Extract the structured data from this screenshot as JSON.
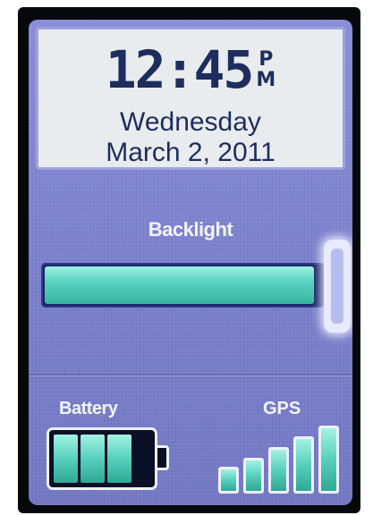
{
  "clock": {
    "time": "12:45",
    "meridiem_top": "P",
    "meridiem_bottom": "M",
    "weekday": "Wednesday",
    "date": "March 2, 2011"
  },
  "backlight": {
    "label": "Backlight",
    "level": 0.97
  },
  "battery": {
    "label": "Battery",
    "cells_filled": 3,
    "cells_total": 4
  },
  "gps": {
    "label": "GPS",
    "bars_filled": 5,
    "bars_total": 5
  },
  "colors": {
    "screen_bg": "#7e83cf",
    "accent_fill": "#56d0bb",
    "text_dark": "#1d2d5e",
    "text_light": "#f2f4ff"
  }
}
